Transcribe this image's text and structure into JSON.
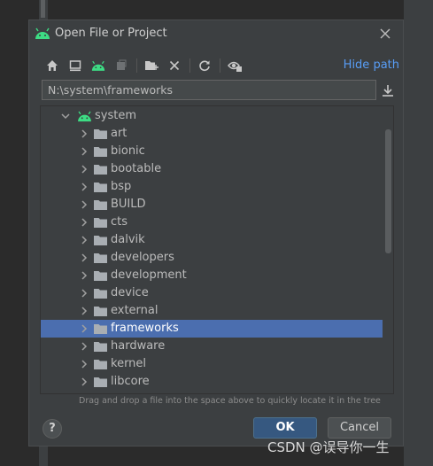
{
  "dialog": {
    "title": "Open File or Project",
    "hide_path_label": "Hide path",
    "path_value": "N:\\system\\frameworks",
    "hint": "Drag and drop a file into the space above to quickly locate it in the tree",
    "ok_label": "OK",
    "cancel_label": "Cancel",
    "help_label": "?"
  },
  "toolbar": {
    "icons": [
      "home-icon",
      "desktop-icon",
      "android-icon",
      "module-icon",
      "new-folder-icon",
      "delete-icon",
      "refresh-icon",
      "show-hidden-icon"
    ]
  },
  "tree": {
    "root": "system",
    "items": [
      {
        "label": "art"
      },
      {
        "label": "bionic"
      },
      {
        "label": "bootable"
      },
      {
        "label": "bsp"
      },
      {
        "label": "BUILD"
      },
      {
        "label": "cts"
      },
      {
        "label": "dalvik"
      },
      {
        "label": "developers"
      },
      {
        "label": "development"
      },
      {
        "label": "device"
      },
      {
        "label": "external"
      },
      {
        "label": "frameworks",
        "selected": true
      },
      {
        "label": "hardware"
      },
      {
        "label": "kernel"
      },
      {
        "label": "libcore"
      }
    ]
  },
  "watermark": "CSDN @误导你一生",
  "colors": {
    "accent": "#589df6",
    "selection": "#4b6eaf",
    "android_green": "#3ddc84",
    "folder": "#a9aeb3"
  }
}
